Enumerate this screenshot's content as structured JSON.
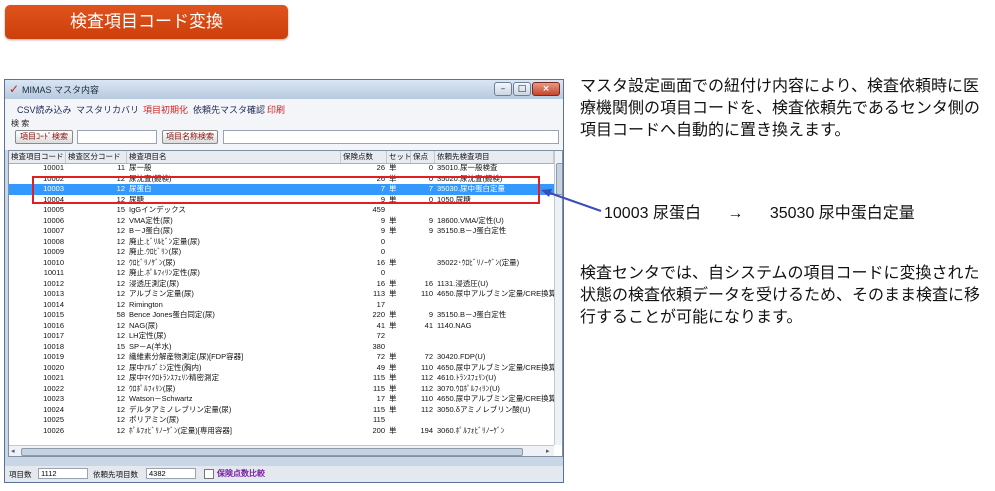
{
  "slide": {
    "title": "検査項目コード変換",
    "desc1": "マスタ設定画面での紐付け内容により、検査依頼時に医療機関側の項目コードを、検査依頼先であるセンタ側の項目コードへ自動的に置き換えます。",
    "mapping_from": "10003 尿蛋白",
    "mapping_arrow": "→",
    "mapping_to": "35030 尿中蛋白定量",
    "desc2": "検査センタでは、自システムの項目コードに変換された状態の検査依頼データを受けるため、そのまま検査に移行することが可能になります。"
  },
  "window": {
    "title": "MIMAS マスタ内容",
    "min_glyph": "–",
    "max_glyph": "□",
    "close_glyph": "×"
  },
  "menu": {
    "items": [
      "CSV読み込み",
      "マスタリカバリ",
      "項目初期化",
      "依頼先マスタ確認",
      "印刷"
    ]
  },
  "search": {
    "label": "検 索",
    "code_button": "項目ｺｰﾄﾞ検索",
    "name_button": "項目名称検索"
  },
  "table": {
    "columns": [
      "検査項目コード",
      "検査区分コード",
      "検査項目名",
      "保険点数",
      "セット",
      "保点",
      "依頼先検査項目"
    ],
    "rows": [
      [
        "10001",
        "11",
        "尿一般",
        "26",
        "単",
        "0",
        "35010.尿一般検査"
      ],
      [
        "10002",
        "12",
        "尿沈査(鏡検)",
        "26",
        "単",
        "0",
        "35020.尿沈査(鏡検)"
      ],
      [
        "10003",
        "12",
        "尿蛋白",
        "7",
        "単",
        "7",
        "35030.尿中蛋白定量"
      ],
      [
        "10004",
        "12",
        "尿糖",
        "9",
        "単",
        "0",
        "1050.尿糖"
      ],
      [
        "10005",
        "15",
        "IgGインデックス",
        "459",
        "",
        "",
        ""
      ],
      [
        "10006",
        "12",
        "VMA定性(尿)",
        "9",
        "単",
        "9",
        "18600.VMA/定性(U)"
      ],
      [
        "10007",
        "12",
        "B－J蛋白(尿)",
        "9",
        "単",
        "9",
        "35150.B－J蛋白定性"
      ],
      [
        "10008",
        "12",
        "廃止.ﾋﾞﾘﾙﾋﾞﾝ定量(尿)",
        "0",
        "",
        "",
        ""
      ],
      [
        "10009",
        "12",
        "廃止.ｳﾛﾋﾞﾘﾝ(尿)",
        "0",
        "",
        "",
        ""
      ],
      [
        "10010",
        "12",
        "ｳﾛﾋﾞﾘﾉｹﾞﾝ(尿)",
        "16",
        "単",
        "",
        "35022･ｳﾛﾋﾞﾘﾉｰｹﾞﾝ(定量)"
      ],
      [
        "10011",
        "12",
        "廃止.ﾎﾟﾙﾌｨﾘﾝ定性(尿)",
        "0",
        "",
        "",
        ""
      ],
      [
        "10012",
        "12",
        "浸透圧測定(尿)",
        "16",
        "単",
        "16",
        "1131.浸透圧(U)"
      ],
      [
        "10013",
        "12",
        "アルブミン定量(尿)",
        "113",
        "単",
        "110",
        "4650.尿中アルブミン定量/CRE換算"
      ],
      [
        "10014",
        "12",
        "Rimington",
        "17",
        "",
        "",
        ""
      ],
      [
        "10015",
        "58",
        "Bence Jones蛋白同定(尿)",
        "220",
        "単",
        "9",
        "35150.B－J蛋白定性"
      ],
      [
        "10016",
        "12",
        "NAG(尿)",
        "41",
        "単",
        "41",
        "1140.NAG"
      ],
      [
        "10017",
        "12",
        "LH定性(尿)",
        "72",
        "",
        "",
        ""
      ],
      [
        "10018",
        "15",
        "SP－A(羊水)",
        "380",
        "",
        "",
        ""
      ],
      [
        "10019",
        "12",
        "繊維素分解産物測定(尿)[FDP容器]",
        "72",
        "単",
        "72",
        "30420.FDP(U)"
      ],
      [
        "10020",
        "12",
        "尿中ｱﾙﾌﾞﾐﾝ定性(胸内)",
        "49",
        "単",
        "110",
        "4650.尿中アルブミン定量/CRE換算"
      ],
      [
        "10021",
        "12",
        "尿中ﾏｲｸﾛﾄﾗﾝｽﾌｪﾘﾝ精密測定",
        "115",
        "単",
        "112",
        "4610.ﾄﾗﾝｽﾌｪﾘﾝ(U)"
      ],
      [
        "10022",
        "12",
        "ｳﾛﾎﾟﾙﾌｨﾘﾝ(尿)",
        "115",
        "単",
        "112",
        "3070.ｳﾛﾎﾟﾙﾌｨﾘﾝ(U)"
      ],
      [
        "10023",
        "12",
        "Watson－Schwartz",
        "17",
        "単",
        "110",
        "4650.尿中アルブミン定量/CRE換算"
      ],
      [
        "10024",
        "12",
        "デルタアミノレブリン定量(尿)",
        "115",
        "単",
        "112",
        "3050.δアミノレブリン酸(U)"
      ],
      [
        "10025",
        "12",
        "ポリアミン(尿)",
        "115",
        "",
        "",
        ""
      ],
      [
        "10026",
        "12",
        "ﾎﾟﾙﾌｫﾋﾞﾘﾉｰｹﾞﾝ(定量)[専用容器]",
        "200",
        "単",
        "194",
        "3060.ﾎﾟﾙﾌｫﾋﾞﾘﾉｰｹﾞﾝ"
      ]
    ],
    "selected_index": 2,
    "scroll_left": "◂",
    "scroll_right": "▸"
  },
  "status": {
    "item_count_label": "項目数",
    "item_count": "1112",
    "dest_count_label": "依頼先項目数",
    "dest_count": "4382",
    "compare_label": "保険点数比較"
  },
  "colors": {
    "title_badge": "#d94a15",
    "selection": "#3399ff",
    "highlight": "#e02020",
    "arrow": "#3b4bb8"
  }
}
